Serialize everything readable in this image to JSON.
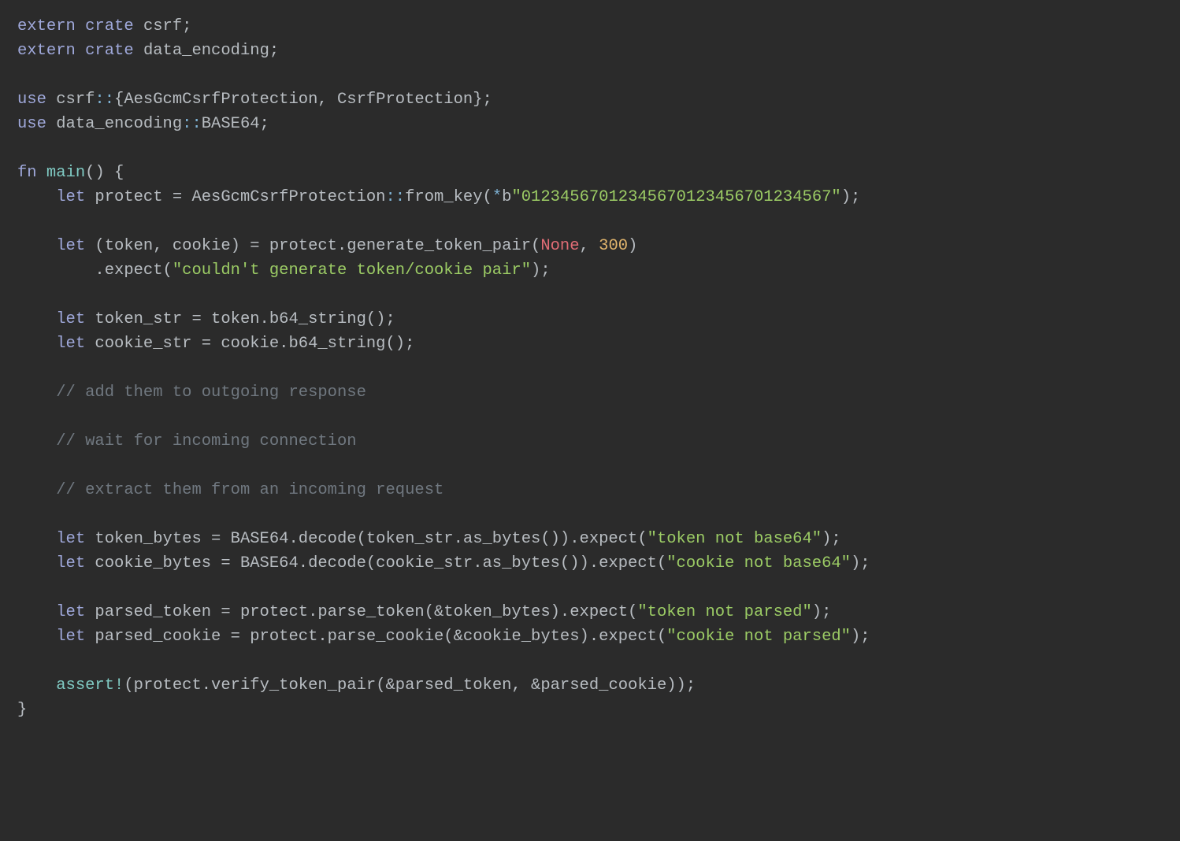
{
  "rows": [
    {
      "indent": 0,
      "tokens": [
        {
          "c": "kw",
          "t": "extern"
        },
        {
          "c": "pn",
          "t": " "
        },
        {
          "c": "kw",
          "t": "crate"
        },
        {
          "c": "pn",
          "t": " csrf;"
        }
      ]
    },
    {
      "indent": 0,
      "tokens": [
        {
          "c": "kw",
          "t": "extern"
        },
        {
          "c": "pn",
          "t": " "
        },
        {
          "c": "kw",
          "t": "crate"
        },
        {
          "c": "pn",
          "t": " data_encoding;"
        }
      ]
    },
    {
      "indent": 0,
      "tokens": []
    },
    {
      "indent": 0,
      "tokens": [
        {
          "c": "kw",
          "t": "use"
        },
        {
          "c": "pn",
          "t": " csrf"
        },
        {
          "c": "op",
          "t": "::"
        },
        {
          "c": "pn",
          "t": "{AesGcmCsrfProtection, CsrfProtection};"
        }
      ]
    },
    {
      "indent": 0,
      "tokens": [
        {
          "c": "kw",
          "t": "use"
        },
        {
          "c": "pn",
          "t": " data_encoding"
        },
        {
          "c": "op",
          "t": "::"
        },
        {
          "c": "pn",
          "t": "BASE64;"
        }
      ]
    },
    {
      "indent": 0,
      "tokens": []
    },
    {
      "indent": 0,
      "tokens": [
        {
          "c": "kw",
          "t": "fn"
        },
        {
          "c": "pn",
          "t": " "
        },
        {
          "c": "fn",
          "t": "main"
        },
        {
          "c": "pn",
          "t": "() {"
        }
      ]
    },
    {
      "indent": 1,
      "tokens": [
        {
          "c": "kw",
          "t": "let"
        },
        {
          "c": "pn",
          "t": " protect = AesGcmCsrfProtection"
        },
        {
          "c": "op",
          "t": "::"
        },
        {
          "c": "pn",
          "t": "from_key("
        },
        {
          "c": "star",
          "t": "*"
        },
        {
          "c": "bpfx",
          "t": "b"
        },
        {
          "c": "str",
          "t": "\"01234567012345670123456701234567\""
        },
        {
          "c": "pn",
          "t": ");"
        }
      ]
    },
    {
      "indent": 0,
      "tokens": []
    },
    {
      "indent": 1,
      "tokens": [
        {
          "c": "kw",
          "t": "let"
        },
        {
          "c": "pn",
          "t": " (token, cookie) = protect.generate_token_pair("
        },
        {
          "c": "none",
          "t": "None"
        },
        {
          "c": "pn",
          "t": ", "
        },
        {
          "c": "num",
          "t": "300"
        },
        {
          "c": "pn",
          "t": ")"
        }
      ]
    },
    {
      "indent": 2,
      "tokens": [
        {
          "c": "pn",
          "t": ".expect("
        },
        {
          "c": "str",
          "t": "\"couldn't generate token/cookie pair\""
        },
        {
          "c": "pn",
          "t": ");"
        }
      ]
    },
    {
      "indent": 0,
      "tokens": []
    },
    {
      "indent": 1,
      "tokens": [
        {
          "c": "kw",
          "t": "let"
        },
        {
          "c": "pn",
          "t": " token_str = token.b64_string();"
        }
      ]
    },
    {
      "indent": 1,
      "tokens": [
        {
          "c": "kw",
          "t": "let"
        },
        {
          "c": "pn",
          "t": " cookie_str = cookie.b64_string();"
        }
      ]
    },
    {
      "indent": 0,
      "tokens": []
    },
    {
      "indent": 1,
      "tokens": [
        {
          "c": "cmt",
          "t": "// add them to outgoing response"
        }
      ]
    },
    {
      "indent": 0,
      "tokens": []
    },
    {
      "indent": 1,
      "tokens": [
        {
          "c": "cmt",
          "t": "// wait for incoming connection"
        }
      ]
    },
    {
      "indent": 0,
      "tokens": []
    },
    {
      "indent": 1,
      "tokens": [
        {
          "c": "cmt",
          "t": "// extract them from an incoming request"
        }
      ]
    },
    {
      "indent": 0,
      "tokens": []
    },
    {
      "indent": 1,
      "tokens": [
        {
          "c": "kw",
          "t": "let"
        },
        {
          "c": "pn",
          "t": " token_bytes = BASE64.decode(token_str.as_bytes()).expect("
        },
        {
          "c": "str",
          "t": "\"token not base64\""
        },
        {
          "c": "pn",
          "t": ");"
        }
      ]
    },
    {
      "indent": 1,
      "tokens": [
        {
          "c": "kw",
          "t": "let"
        },
        {
          "c": "pn",
          "t": " cookie_bytes = BASE64.decode(cookie_str.as_bytes()).expect("
        },
        {
          "c": "str",
          "t": "\"cookie not base64\""
        },
        {
          "c": "pn",
          "t": ");"
        }
      ]
    },
    {
      "indent": 0,
      "tokens": []
    },
    {
      "indent": 1,
      "tokens": [
        {
          "c": "kw",
          "t": "let"
        },
        {
          "c": "pn",
          "t": " parsed_token = protect.parse_token(&token_bytes).expect("
        },
        {
          "c": "str",
          "t": "\"token not parsed\""
        },
        {
          "c": "pn",
          "t": ");"
        }
      ]
    },
    {
      "indent": 1,
      "tokens": [
        {
          "c": "kw",
          "t": "let"
        },
        {
          "c": "pn",
          "t": " parsed_cookie = protect.parse_cookie(&cookie_bytes).expect("
        },
        {
          "c": "str",
          "t": "\"cookie not parsed\""
        },
        {
          "c": "pn",
          "t": ");"
        }
      ]
    },
    {
      "indent": 0,
      "tokens": []
    },
    {
      "indent": 1,
      "tokens": [
        {
          "c": "mac",
          "t": "assert!"
        },
        {
          "c": "pn",
          "t": "(protect.verify_token_pair(&parsed_token, &parsed_cookie));"
        }
      ]
    },
    {
      "indent": 0,
      "tokens": [
        {
          "c": "pn",
          "t": "}"
        }
      ]
    }
  ],
  "indent_unit": "    "
}
